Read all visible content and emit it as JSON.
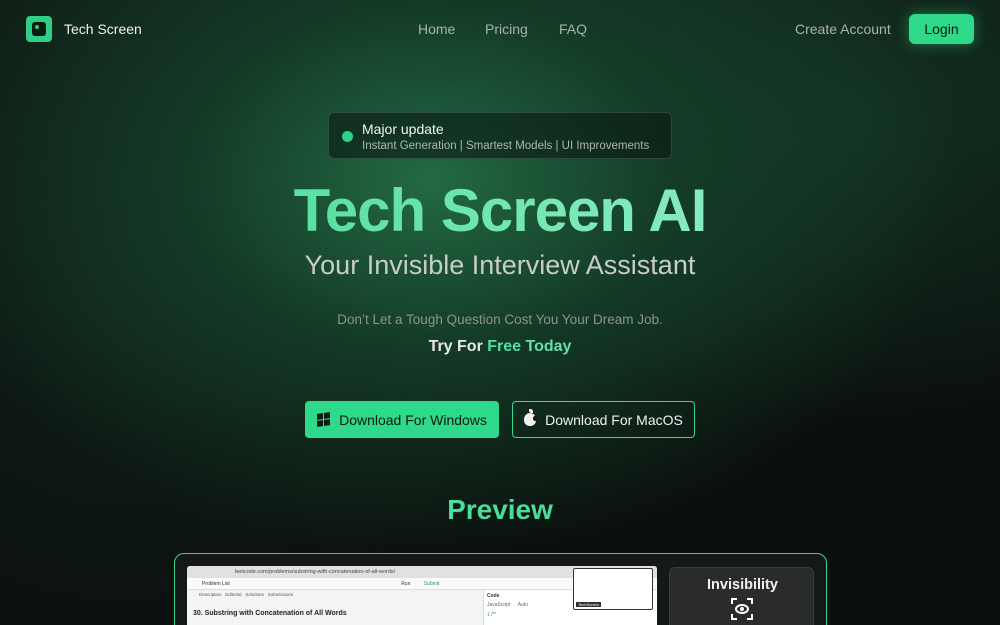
{
  "nav": {
    "brand": "Tech Screen",
    "links": [
      "Home",
      "Pricing",
      "FAQ"
    ],
    "create_account": "Create Account",
    "login": "Login"
  },
  "badge": {
    "title": "Major update",
    "subtitle": "Instant Generation | Smartest Models | UI Improvements"
  },
  "hero": {
    "title": "Tech Screen AI",
    "subtitle": "Your Invisible Interview Assistant",
    "tagline": "Don’t Let a Tough Question Cost You Your Dream Job.",
    "try_prefix": "Try For",
    "try_free": "Free",
    "try_today": "Today"
  },
  "buttons": {
    "windows": "Download For Windows",
    "macos": "Download For MacOS"
  },
  "preview": {
    "title": "Preview",
    "screenshot": {
      "url": "leetcode.com/problems/substring-with-concatenation-of-all-words/",
      "toolbar": "Problem List",
      "run": "Run",
      "submit": "Submit",
      "tabs": [
        "Description",
        "Editorial",
        "Solutions",
        "Submissions"
      ],
      "problem": "30. Substring with Concatenation of All Words",
      "code_tab": "Code",
      "language": "JavaScript",
      "auto": "Auto",
      "code_line": "1  /**",
      "mini_tag": "TechScreen"
    },
    "card_label": "Invisibility"
  },
  "colors": {
    "accent": "#2ed98a",
    "background": "#0b0f0d"
  },
  "icons": {
    "logo": "tech-screen-logo-icon",
    "windows": "windows-icon",
    "macos": "apple-icon",
    "invisibility": "eye-scan-icon"
  }
}
